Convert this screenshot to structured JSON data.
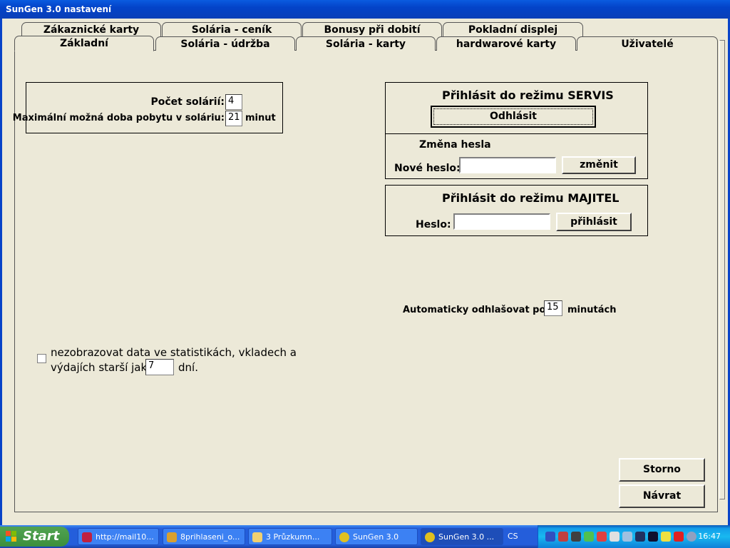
{
  "window": {
    "title": "SunGen 3.0 nastavení"
  },
  "tabs_back": [
    "Zákaznické karty",
    "Solária - ceník",
    "Bonusy při dobití",
    "Pokladní displej"
  ],
  "tabs_front": [
    "Základní",
    "Solária - údržba",
    "Solária - karty",
    "hardwarové karty",
    "Uživatelé"
  ],
  "basic": {
    "solar_count_label": "Počet solárií:",
    "solar_count_value": "4",
    "max_time_label": "Maximální možná doba pobytu v soláriu:",
    "max_time_value": "21",
    "max_time_unit": "minut"
  },
  "servis": {
    "title": "Přihlásit do režimu SERVIS",
    "logout_label": "Odhlásit",
    "change_password_title": "Změna hesla",
    "new_password_label": "Nové heslo:",
    "new_password_value": "",
    "change_button": "změnit"
  },
  "majitel": {
    "title": "Přihlásit do režimu MAJITEL",
    "password_label": "Heslo:",
    "password_value": "",
    "login_button": "přihlásit"
  },
  "auto_logout": {
    "label": "Automaticky odhlašovat po:",
    "value": "15",
    "unit": "minutách"
  },
  "hide_data": {
    "checked": false,
    "label_line1": "nezobrazovat data ve statistikách, vkladech a",
    "label_line2": "výdajích starší jak",
    "days_value": "7",
    "days_unit": "dní."
  },
  "buttons": {
    "cancel": "Storno",
    "back": "Návrat"
  },
  "taskbar": {
    "start_label": "Start",
    "tasks": [
      "http://mail10...",
      "8prihlaseni_o...",
      "3 Průzkumn...",
      "SunGen 3.0",
      "SunGen 3.0 ..."
    ],
    "language": "CS",
    "clock": "16:47"
  }
}
